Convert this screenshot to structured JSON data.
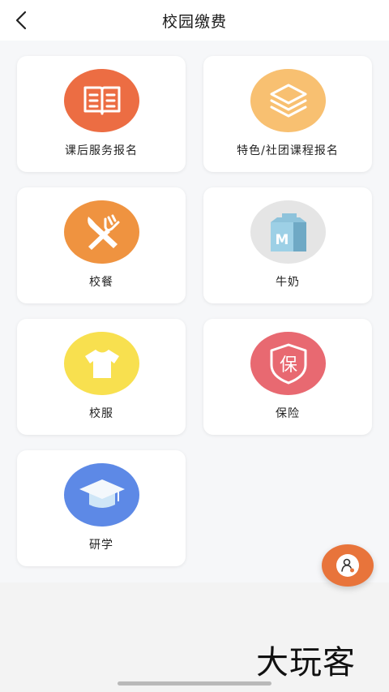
{
  "header": {
    "title": "校园缴费",
    "back_icon": "chevron-left-icon"
  },
  "cards": [
    {
      "label": "课后服务报名",
      "icon": "book-icon",
      "color": "#ec6d43"
    },
    {
      "label": "特色/社团课程报名",
      "icon": "layers-icon",
      "color": "#f8c071"
    },
    {
      "label": "校餐",
      "icon": "fork-knife-icon",
      "color": "#ef9340"
    },
    {
      "label": "牛奶",
      "icon": "milk-carton-icon",
      "color": "#e5e5e5"
    },
    {
      "label": "校服",
      "icon": "tshirt-icon",
      "color": "#f8e04f"
    },
    {
      "label": "保险",
      "icon": "insurance-shield-icon",
      "color": "#e86971"
    },
    {
      "label": "研学",
      "icon": "graduation-cap-icon",
      "color": "#5d89e6"
    }
  ],
  "watermark": "大玩客",
  "fab": {
    "icon": "user-service-icon",
    "color": "#e8743b"
  }
}
